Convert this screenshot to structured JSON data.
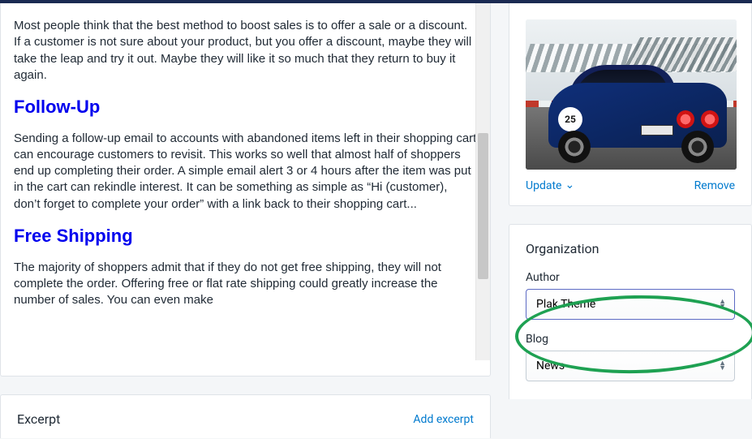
{
  "editor": {
    "p1": "Most people think that the best method to boost sales is to offer a sale or a discount. If a customer is not sure about your product, but you offer a discount, maybe they will take the leap and try it out. Maybe they will like it so much that they return to buy it again.",
    "h2a": "Follow-Up",
    "p2": "Sending a follow-up email to accounts with abandoned items left in their shopping cart can encourage customers to revisit. This works so well that almost half of shoppers end up completing their order. A simple email alert 3 or 4 hours after the item was put in the cart can rekindle interest. It can be something as simple as “Hi (customer), don’t forget to complete your order” with a link back to their shopping cart...",
    "h2b": "Free Shipping",
    "p3": "The majority of shoppers admit that if they do not get free shipping, they will not complete the order. Offering free or flat rate shipping could greatly increase the number of sales. You can even make"
  },
  "excerpt": {
    "title": "Excerpt",
    "add": "Add excerpt"
  },
  "image": {
    "badge": "25",
    "update": "Update",
    "remove": "Remove"
  },
  "org": {
    "title": "Organization",
    "author_label": "Author",
    "author_value": "Plak Theme",
    "blog_label": "Blog",
    "blog_value": "News"
  }
}
